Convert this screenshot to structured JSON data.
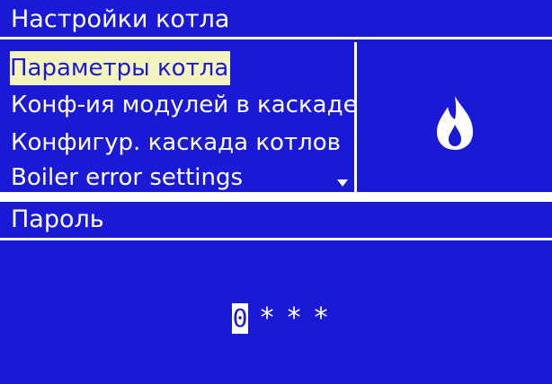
{
  "menu_screen": {
    "title": "Настройки котла",
    "items": [
      {
        "label": "Параметры котла",
        "selected": true
      },
      {
        "label": "Конф-ия модулей в каскаде",
        "selected": false
      },
      {
        "label": "Конфигур. каскада котлов",
        "selected": false
      },
      {
        "label": "Boiler error settings",
        "selected": false
      }
    ],
    "side_icon": "flame-icon",
    "scroll_indicator_icon": "scroll-down-arrow-icon"
  },
  "password_screen": {
    "title": "Пароль",
    "digit_current": "0",
    "mask_chars": [
      "*",
      "*",
      "*"
    ]
  },
  "colors": {
    "screen_background": "#1a1ad6",
    "text": "#ffffff",
    "selection_highlight": "#f4f5bd"
  }
}
